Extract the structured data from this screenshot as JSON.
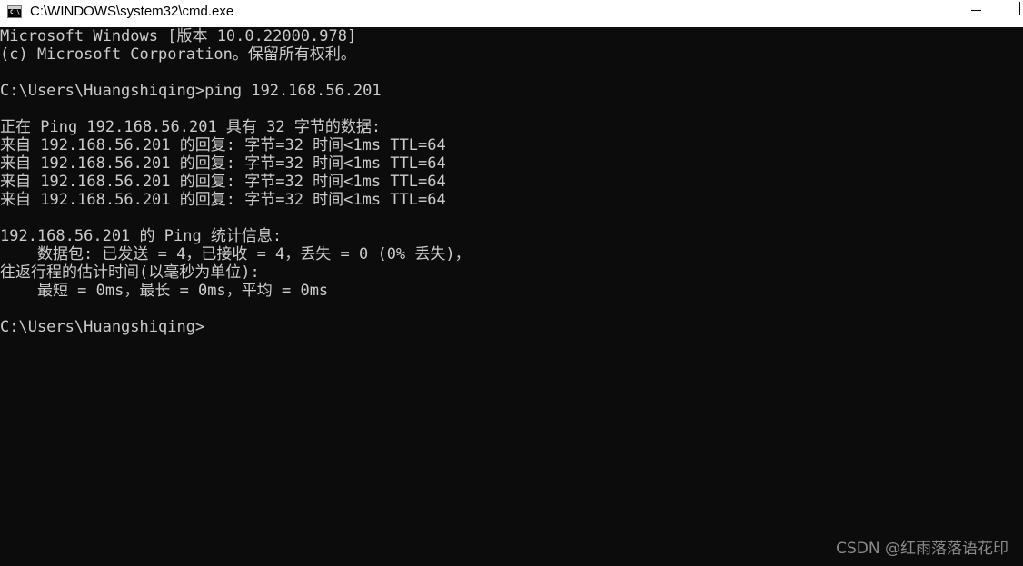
{
  "window": {
    "title": "C:\\WINDOWS\\system32\\cmd.exe",
    "icon": "cmd-icon"
  },
  "console": {
    "lines": [
      "Microsoft Windows [版本 10.0.22000.978]",
      "(c) Microsoft Corporation。保留所有权利。",
      "",
      "C:\\Users\\Huangshiqing>ping 192.168.56.201",
      "",
      "正在 Ping 192.168.56.201 具有 32 字节的数据:",
      "来自 192.168.56.201 的回复: 字节=32 时间<1ms TTL=64",
      "来自 192.168.56.201 的回复: 字节=32 时间<1ms TTL=64",
      "来自 192.168.56.201 的回复: 字节=32 时间<1ms TTL=64",
      "来自 192.168.56.201 的回复: 字节=32 时间<1ms TTL=64",
      "",
      "192.168.56.201 的 Ping 统计信息:",
      "    数据包: 已发送 = 4，已接收 = 4，丢失 = 0 (0% 丢失)，",
      "往返行程的估计时间(以毫秒为单位):",
      "    最短 = 0ms，最长 = 0ms，平均 = 0ms",
      "",
      "C:\\Users\\Huangshiqing>"
    ]
  },
  "watermark": "CSDN @红雨落落语花印"
}
